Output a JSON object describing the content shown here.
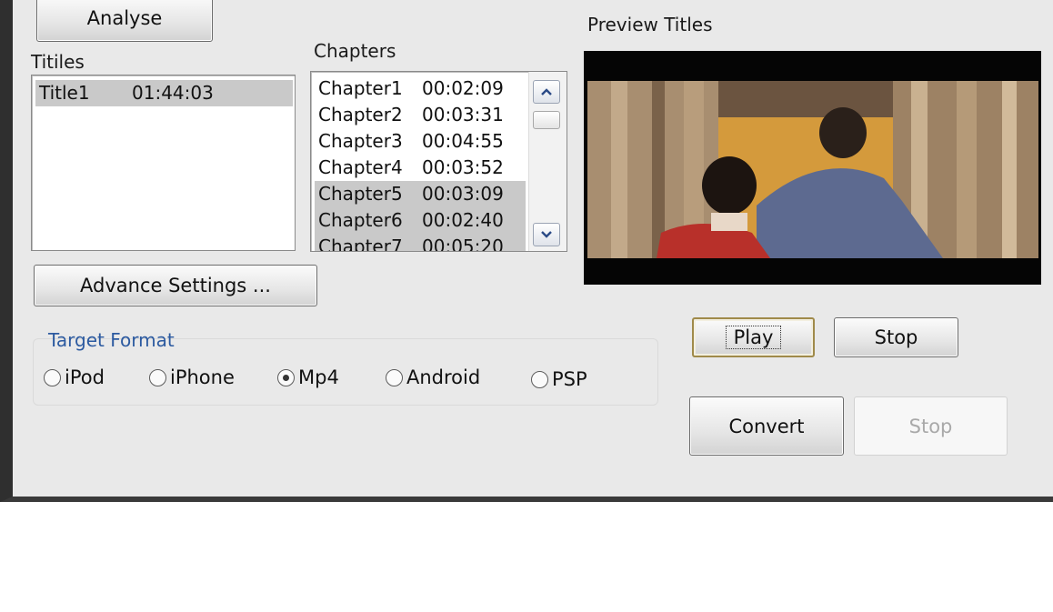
{
  "buttons": {
    "analyse": "Analyse",
    "advance_settings": "Advance Settings ...",
    "play": "Play",
    "stop_preview": "Stop",
    "convert": "Convert",
    "stop_convert": "Stop"
  },
  "titles": {
    "label": "Titiles",
    "items": [
      {
        "name": "Title1",
        "duration": "01:44:03",
        "selected": true
      }
    ]
  },
  "chapters": {
    "label": "Chapters",
    "items": [
      {
        "name": "Chapter1",
        "duration": "00:02:09",
        "selected": false
      },
      {
        "name": "Chapter2",
        "duration": "00:03:31",
        "selected": false
      },
      {
        "name": "Chapter3",
        "duration": "00:04:55",
        "selected": false
      },
      {
        "name": "Chapter4",
        "duration": "00:03:52",
        "selected": false
      },
      {
        "name": "Chapter5",
        "duration": "00:03:09",
        "selected": true
      },
      {
        "name": "Chapter6",
        "duration": "00:02:40",
        "selected": true
      },
      {
        "name": "Chapter7",
        "duration": "00:05:20",
        "selected": true
      }
    ],
    "scroll_up_icon": "chevron-up-icon",
    "scroll_down_icon": "chevron-down-icon"
  },
  "preview": {
    "label": "Preview Titles"
  },
  "target_format": {
    "label": "Target Format",
    "label_color": "#2c5aa0",
    "options": [
      {
        "label": "iPod",
        "checked": false
      },
      {
        "label": "iPhone",
        "checked": false
      },
      {
        "label": "Mp4",
        "checked": true
      },
      {
        "label": "Android",
        "checked": false
      },
      {
        "label": "PSP",
        "checked": false
      }
    ]
  }
}
